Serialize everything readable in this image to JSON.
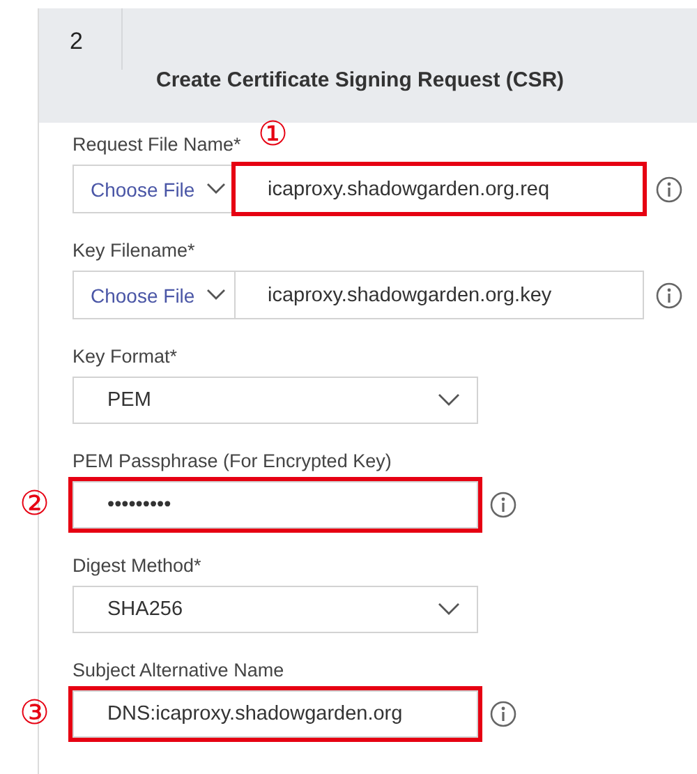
{
  "step": {
    "number": "2",
    "title": "Create Certificate Signing Request (CSR)"
  },
  "fields": [
    {
      "kind": "file",
      "label": "Request File Name*",
      "choose_label": "Choose File",
      "value": "icaproxy.shadowgarden.org.req",
      "info": true,
      "highlighted": true,
      "callout": "①"
    },
    {
      "kind": "file",
      "label": "Key Filename*",
      "choose_label": "Choose File",
      "value": "icaproxy.shadowgarden.org.key",
      "info": true,
      "highlighted": false
    },
    {
      "kind": "select",
      "label": "Key Format*",
      "value": "PEM",
      "info": false,
      "highlighted": false
    },
    {
      "kind": "text",
      "label": "PEM Passphrase (For Encrypted Key)",
      "value": "•••••••••",
      "info": true,
      "highlighted": true,
      "callout": "②"
    },
    {
      "kind": "select",
      "label": "Digest Method*",
      "value": "SHA256",
      "info": false,
      "highlighted": false
    },
    {
      "kind": "text",
      "label": "Subject Alternative Name",
      "value": "DNS:icaproxy.shadowgarden.org",
      "info": true,
      "highlighted": true,
      "callout": "③"
    }
  ]
}
